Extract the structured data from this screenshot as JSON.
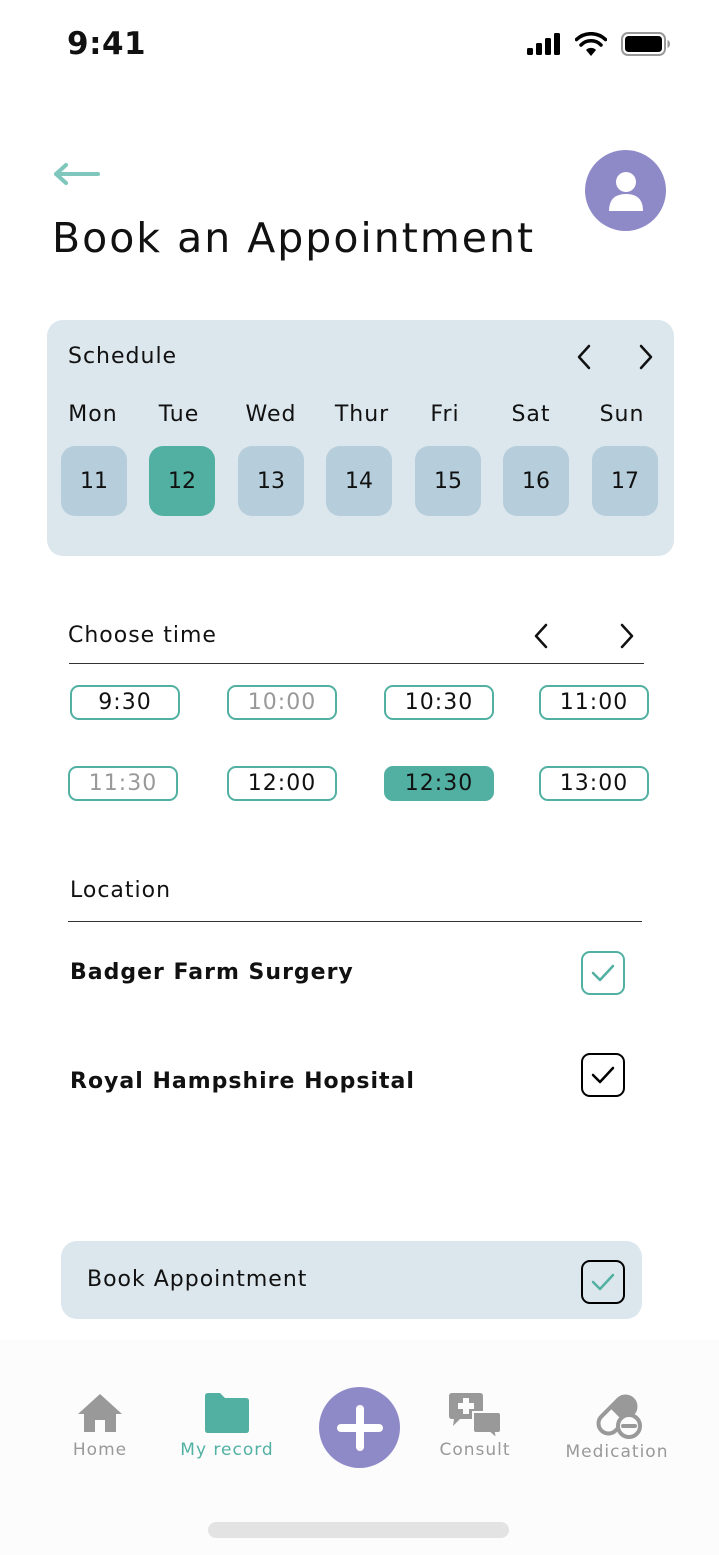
{
  "status_bar": {
    "time": "9:41"
  },
  "header": {
    "title": "Book an Appointment"
  },
  "schedule": {
    "label": "Schedule",
    "days": [
      {
        "name": "Mon",
        "date": "11",
        "selected": false
      },
      {
        "name": "Tue",
        "date": "12",
        "selected": true
      },
      {
        "name": "Wed",
        "date": "13",
        "selected": false
      },
      {
        "name": "Thur",
        "date": "14",
        "selected": false
      },
      {
        "name": "Fri",
        "date": "15",
        "selected": false
      },
      {
        "name": "Sat",
        "date": "16",
        "selected": false
      },
      {
        "name": "Sun",
        "date": "17",
        "selected": false
      }
    ]
  },
  "time": {
    "label": "Choose time",
    "slots": [
      {
        "time": "9:30",
        "state": "available"
      },
      {
        "time": "10:00",
        "state": "disabled"
      },
      {
        "time": "10:30",
        "state": "available"
      },
      {
        "time": "11:00",
        "state": "available"
      },
      {
        "time": "11:30",
        "state": "disabled"
      },
      {
        "time": "12:00",
        "state": "available"
      },
      {
        "time": "12:30",
        "state": "selected"
      },
      {
        "time": "13:00",
        "state": "available"
      }
    ]
  },
  "location": {
    "label": "Location",
    "options": [
      {
        "name": "Badger Farm Surgery",
        "checked_style": "teal"
      },
      {
        "name": "Royal Hampshire Hopsital",
        "checked_style": "black"
      }
    ]
  },
  "book_button": {
    "label": "Book Appointment"
  },
  "tab_bar": {
    "tabs": [
      {
        "label": "Home",
        "icon": "home-icon",
        "active": false
      },
      {
        "label": "My record",
        "icon": "folder-icon",
        "active": true
      },
      {
        "label": "Consult",
        "icon": "chat-medical-icon",
        "active": false
      },
      {
        "label": "Medication",
        "icon": "pill-icon",
        "active": false
      }
    ],
    "fab_icon": "plus-icon"
  },
  "colors": {
    "accent": "#52b0a2",
    "avatar": "#8e8ac8",
    "card_bg": "#dbe6ed",
    "chip_bg": "#b6cedb",
    "inactive_tab": "#999999"
  }
}
